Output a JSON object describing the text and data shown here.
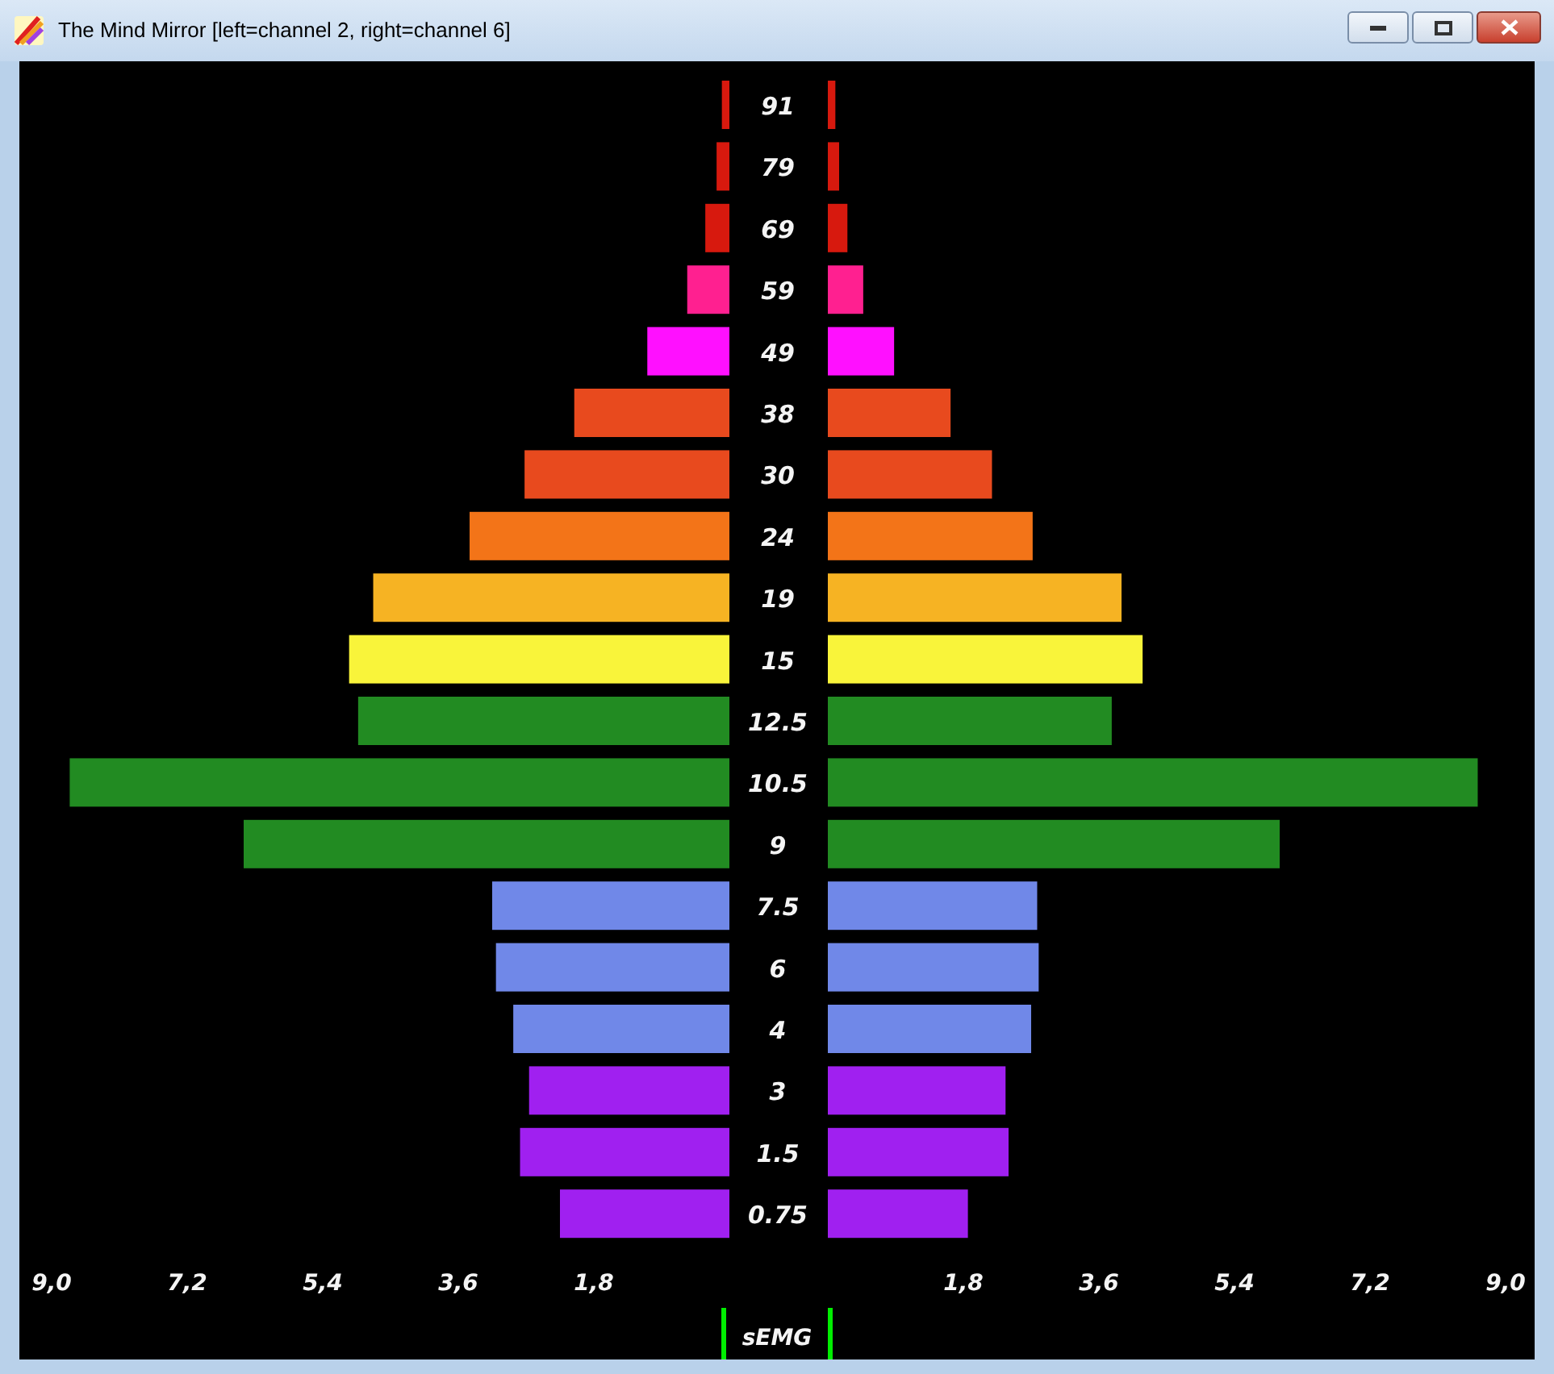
{
  "window": {
    "title": "The Mind Mirror [left=channel 2, right=channel 6]"
  },
  "left_chart": {
    "chart_data": {
      "type": "bar",
      "orientation": "horizontal",
      "categories": [
        "91",
        "79",
        "69",
        "59",
        "49",
        "38",
        "30",
        "24",
        "19",
        "15",
        "12.5",
        "10.5",
        "9",
        "7.5",
        "6",
        "4",
        "3",
        "1.5",
        "0.75"
      ],
      "series": [
        {
          "colors": [
            "#d7190e",
            "#d7190e",
            "#d7190e",
            "#ff2090",
            "#ff10ff",
            "#e84a1e",
            "#e84a1e",
            "#f37418",
            "#f6b323",
            "#f9f43a",
            "#228b22",
            "#228b22",
            "#228b22",
            "#7088e8",
            "#7088e8",
            "#7088e8",
            "#a020f0",
            "#a020f0",
            "#a020f0"
          ],
          "values": [
            0.1,
            0.17,
            0.32,
            0.56,
            1.09,
            2.06,
            2.72,
            3.45,
            4.73,
            5.05,
            4.93,
            8.76,
            6.45,
            3.15,
            3.1,
            2.87,
            2.66,
            2.78,
            2.25
          ]
        }
      ],
      "xlim": [
        9,
        0
      ],
      "xticks": [
        {
          "value": 9,
          "label": "9,0"
        },
        {
          "value": 7.2,
          "label": "7,2"
        },
        {
          "value": 5.4,
          "label": "5,4"
        },
        {
          "value": 3.6,
          "label": "3,6"
        },
        {
          "value": 1.8,
          "label": "1,8"
        }
      ]
    }
  },
  "right_chart": {
    "chart_data": {
      "type": "bar",
      "orientation": "horizontal",
      "series": [
        {
          "colors": [
            "#d7190e",
            "#d7190e",
            "#d7190e",
            "#ff2090",
            "#ff10ff",
            "#e84a1e",
            "#e84a1e",
            "#f37418",
            "#f6b323",
            "#f9f43a",
            "#228b22",
            "#228b22",
            "#228b22",
            "#7088e8",
            "#7088e8",
            "#7088e8",
            "#a020f0",
            "#a020f0",
            "#a020f0"
          ],
          "values": [
            0.1,
            0.15,
            0.26,
            0.47,
            0.88,
            1.63,
            2.18,
            2.72,
            3.9,
            4.18,
            3.77,
            8.63,
            6.0,
            2.78,
            2.8,
            2.7,
            2.36,
            2.4,
            1.86
          ]
        }
      ],
      "xlim": [
        0,
        9
      ],
      "xticks": [
        {
          "value": 1.8,
          "label": "1,8"
        },
        {
          "value": 3.6,
          "label": "3,6"
        },
        {
          "value": 5.4,
          "label": "5,4"
        },
        {
          "value": 7.2,
          "label": "7,2"
        },
        {
          "value": 9,
          "label": "9,0"
        }
      ]
    }
  },
  "footer_label": "sEMG"
}
